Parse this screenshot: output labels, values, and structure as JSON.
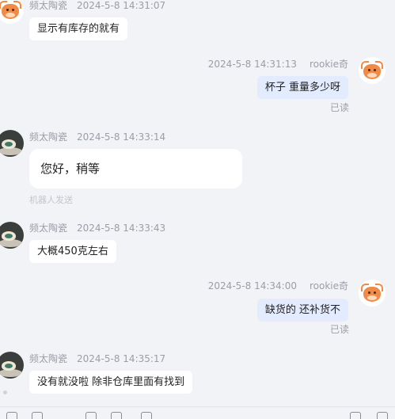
{
  "messages": [
    {
      "sender": "频太陶瓷",
      "time": "2024-5-8 14:31:07",
      "text": "显示有库存的就有"
    },
    {
      "sender": "rookie奇",
      "time": "2024-5-8 14:31:13",
      "text": "杯子 重量多少呀",
      "status": "已读"
    },
    {
      "sender": "频太陶瓷",
      "time": "2024-5-8 14:33:14",
      "text": "您好，稍等",
      "note": "机器人发送"
    },
    {
      "sender": "频太陶瓷",
      "time": "2024-5-8 14:33:43",
      "text": "大概450克左右"
    },
    {
      "sender": "rookie奇",
      "time": "2024-5-8 14:34:00",
      "text": "缺货的  还补货不",
      "status": "已读"
    },
    {
      "sender": "频太陶瓷",
      "time": "2024-5-8 14:35:17",
      "text": "没有就没啦  除非仓库里面有找到"
    }
  ],
  "colors": {
    "background": "#f2f3f7",
    "incoming_bubble": "#ffffff",
    "outgoing_bubble": "#e3ebff",
    "meta_text": "#9b9ea6"
  }
}
